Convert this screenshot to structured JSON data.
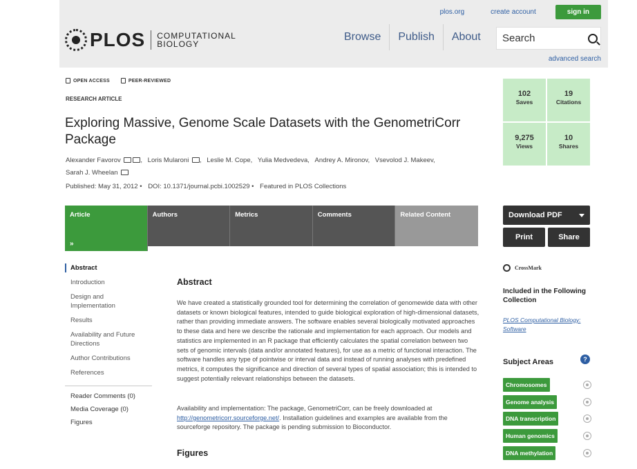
{
  "header": {
    "links": [
      "plos.org",
      "create account",
      "sign in"
    ],
    "logo": {
      "name": "PLOS",
      "journal_line_1": "COMPUTATIONAL",
      "journal_line_2": "BIOLOGY"
    },
    "nav": [
      "Browse",
      "Publish",
      "About"
    ],
    "search_placeholder": "Search",
    "advanced_search": "advanced search"
  },
  "article": {
    "badges": [
      "OPEN ACCESS",
      "PEER-REVIEWED"
    ],
    "type": "RESEARCH ARTICLE",
    "title": "Exploring Massive, Genome Scale Datasets with the GenometriCorr Package",
    "authors": [
      "Alexander Favorov",
      "Loris Mularoni",
      "Leslie M. Cope,",
      "Yulia Medvedeva,",
      "Andrey A. Mironov,",
      "Vsevolod J. Makeev,",
      "Sarah J. Wheelan"
    ],
    "published": "Published: May 31, 2012 •",
    "doi": "DOI: 10.1371/journal.pcbi.1002529 •",
    "featured": "Featured in PLOS Collections",
    "abstract_heading": "Abstract",
    "abstract": "We have created a statistically grounded tool for determining the correlation of genomewide data with other datasets or known biological features, intended to guide biological exploration of high-dimensional datasets, rather than providing immediate answers. The software enables several biologically motivated approaches to these data and here we describe the rationale and implementation for each approach. Our models and statistics are implemented in an R package that efficiently calculates the spatial correlation between two sets of genomic intervals (data and/or annotated features), for use as a metric of functional interaction. The software handles any type of pointwise or interval data and instead of running analyses with predefined metrics, it computes the significance and direction of several types of spatial association; this is intended to suggest potentially relevant relationships between the datasets.",
    "availability_prefix": "Availability and implementation: The package, GenometriCorr, can be freely downloaded at",
    "availability_link": "http://genometricorr.sourceforge.net/",
    "availability_suffix": ". Installation guidelines and examples are available from the sourceforge repository. The package is pending submission to Bioconductor.",
    "figures_heading": "Figures"
  },
  "tabs": [
    "Article",
    "Authors",
    "Metrics",
    "Comments",
    "Related Content"
  ],
  "tab_arrow": "»",
  "toc": {
    "items": [
      "Abstract",
      "Introduction",
      "Design and Implementation",
      "Results",
      "Availability and Future Directions",
      "Author Contributions",
      "References"
    ],
    "extras": [
      "Reader Comments (0)",
      "Media Coverage (0)",
      "Figures"
    ]
  },
  "metrics": [
    {
      "value": "102",
      "label": "Saves"
    },
    {
      "value": "19",
      "label": "Citations"
    },
    {
      "value": "9,275",
      "label": "Views"
    },
    {
      "value": "10",
      "label": "Shares"
    }
  ],
  "actions": {
    "download": "Download PDF",
    "print": "Print",
    "share": "Share"
  },
  "sidebar": {
    "crossmark": "CrossMark",
    "collection_title": "Included in the Following Collection",
    "collection_link": "PLOS Computational Biology: Software",
    "subject_title": "Subject Areas",
    "help": "?",
    "subjects": [
      "Chromosomes",
      "Genome analysis",
      "DNA transcription",
      "Human genomics",
      "DNA methylation"
    ]
  },
  "colors": {
    "accent_green": "#3c9a3c",
    "link_blue": "#2d5ea3",
    "metric_green": "#c7ebc7"
  }
}
